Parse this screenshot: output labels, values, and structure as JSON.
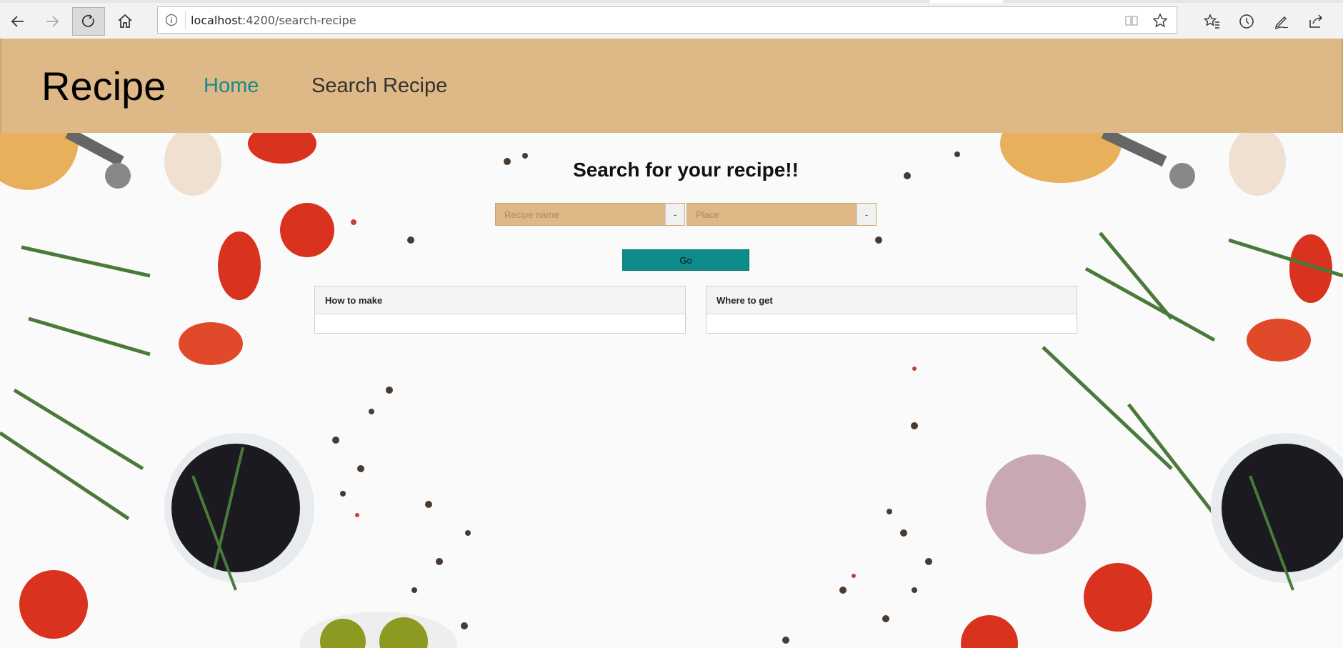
{
  "browser": {
    "url_host": "localhost",
    "url_path": ":4200/search-recipe",
    "back_icon": "arrow-left-icon",
    "forward_icon": "arrow-right-icon",
    "refresh_icon": "refresh-icon",
    "home_icon": "home-icon"
  },
  "header": {
    "brand": "Recipe",
    "nav": {
      "home": "Home",
      "search": "Search Recipe"
    },
    "background_color": "#deb887",
    "active_link_color": "#1a8a8a"
  },
  "search": {
    "title": "Search for your recipe!!",
    "recipe_placeholder": "Recipe name",
    "recipe_addon": "-",
    "place_placeholder": "Place",
    "place_addon": "-",
    "go_label": "Go",
    "go_color": "#0e8c8c"
  },
  "cards": {
    "how_to_make": "How to make",
    "where_to_get": "Where to get"
  }
}
